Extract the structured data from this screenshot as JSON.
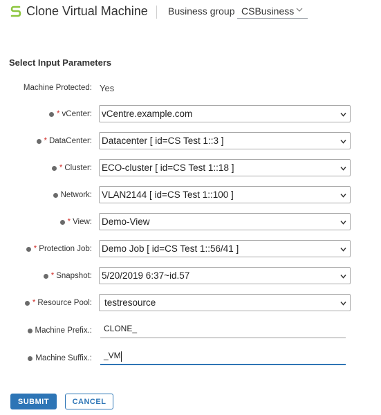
{
  "header": {
    "title": "Clone Virtual Machine",
    "logo_icon": "s-logo-icon",
    "brand_color": "#8dc63f",
    "business_group_label": "Business group",
    "business_group_value": "CSBusiness"
  },
  "form": {
    "section_title": "Select Input Parameters",
    "machine_protected": {
      "label": "Machine Protected:",
      "value": "Yes"
    },
    "vcenter": {
      "label": "vCenter:",
      "value": "vCentre.example.com"
    },
    "datacenter": {
      "label": "DataCenter:",
      "value": "Datacenter [ id=CS Test 1::3 ]"
    },
    "cluster": {
      "label": "Cluster:",
      "value": "ECO-cluster [ id=CS Test 1::18 ]"
    },
    "network": {
      "label": "Network:",
      "value": "VLAN2144 [ id=CS Test 1::100 ]"
    },
    "view": {
      "label": "View:",
      "value": "Demo-View"
    },
    "protection_job": {
      "label": "Protection Job:",
      "value": "Demo Job [ id=CS Test 1::56/41 ]"
    },
    "snapshot": {
      "label": "Snapshot:",
      "value": "5/20/2019 6:37~id.57"
    },
    "resource_pool": {
      "label": "Resource Pool:",
      "value": "testresource"
    },
    "machine_prefix": {
      "label": "Machine Prefix.:",
      "value": "CLONE_"
    },
    "machine_suffix": {
      "label": "Machine Suffix.:",
      "value": "_VM"
    },
    "required_marker": "*"
  },
  "buttons": {
    "submit": "SUBMIT",
    "cancel": "CANCEL"
  },
  "colors": {
    "accent": "#2d75b6",
    "required": "#d0312d"
  }
}
